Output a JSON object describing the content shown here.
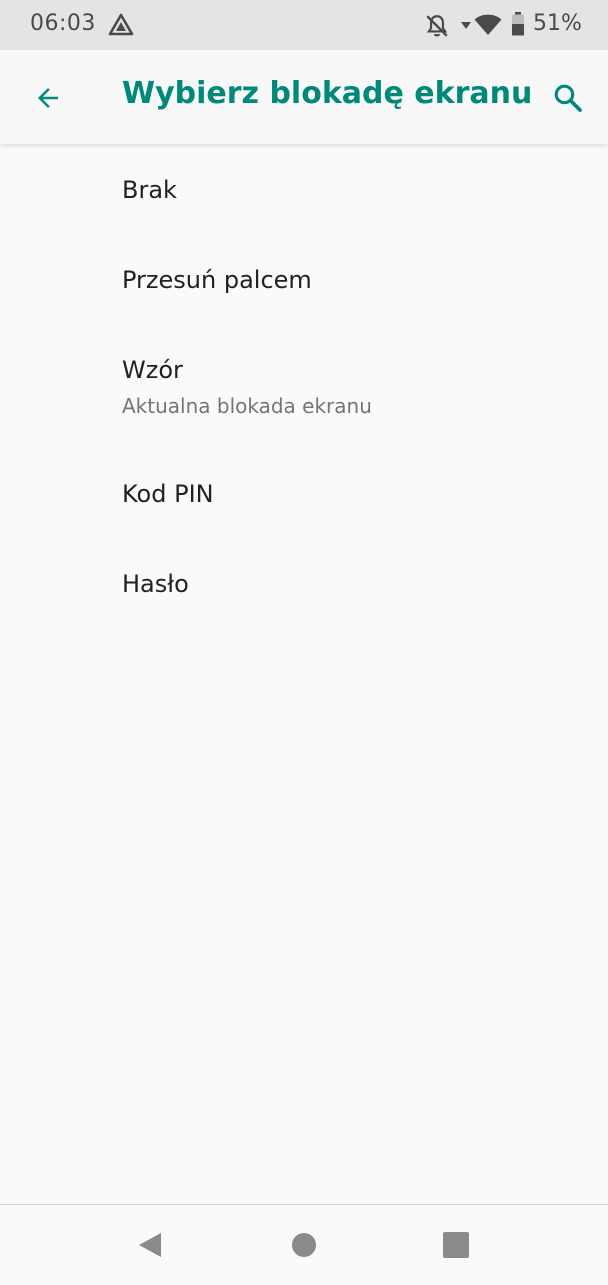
{
  "status_bar": {
    "time": "06:03",
    "battery_percent": "51%",
    "icons": [
      "nav-app-icon",
      "bell-off-icon",
      "dropdown-arrow-icon",
      "wifi-icon",
      "battery-icon"
    ]
  },
  "app_bar": {
    "title": "Wybierz blokadę ekranu",
    "back_icon": "arrow-left-icon",
    "search_icon": "search-icon"
  },
  "options": [
    {
      "title": "Brak"
    },
    {
      "title": "Przesuń palcem"
    },
    {
      "title": "Wzór",
      "subtitle": "Aktualna blokada ekranu"
    },
    {
      "title": "Kod PIN"
    },
    {
      "title": "Hasło"
    }
  ],
  "nav_bar": {
    "icons": [
      "back-triangle-icon",
      "home-circle-icon",
      "recents-square-icon"
    ]
  },
  "colors": {
    "accent": "#00897b",
    "background": "#fafafa",
    "status_bar": "#e4e4e4",
    "primary_text": "#212121",
    "secondary_text": "#757575"
  }
}
